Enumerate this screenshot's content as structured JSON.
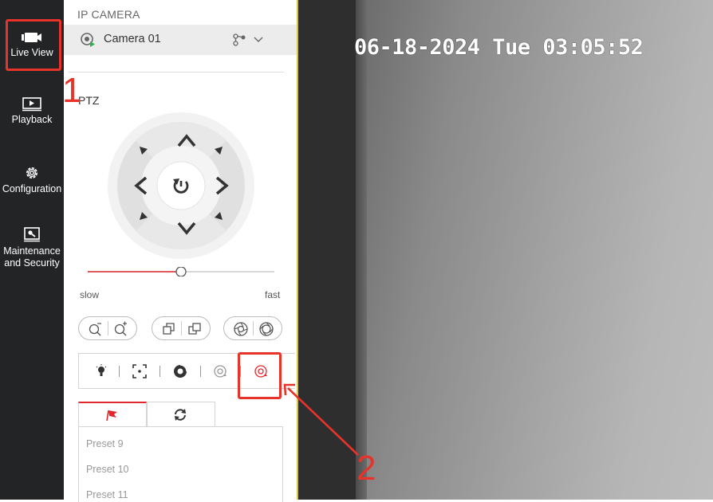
{
  "nav": {
    "items": [
      {
        "label": "Live View",
        "icon": "camera-icon",
        "active": true
      },
      {
        "label": "Playback",
        "icon": "playback-icon"
      },
      {
        "label": "Configuration",
        "icon": "gear-icon"
      },
      {
        "label_line1": "Maintenance",
        "label_line2": "and Security",
        "icon": "maintenance-icon"
      }
    ]
  },
  "panel": {
    "title": "IP CAMERA",
    "camera": {
      "name": "Camera 01"
    },
    "ptz": {
      "title": "PTZ",
      "speed": {
        "slow_label": "slow",
        "fast_label": "fast",
        "level": 0.5
      }
    },
    "presets": [
      "Preset 9",
      "Preset 10",
      "Preset 11"
    ]
  },
  "video": {
    "osd_timestamp": "06-18-2024 Tue 03:05:52"
  },
  "annotations": {
    "step1": "1",
    "step2": "2",
    "color": "#e8332a"
  },
  "colors": {
    "accent": "#e0282e",
    "nav_bg": "#222426"
  }
}
